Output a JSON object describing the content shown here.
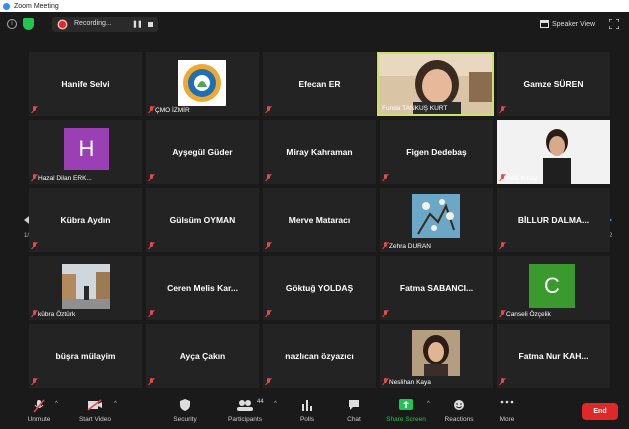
{
  "window": {
    "title": "Zoom Meeting"
  },
  "topbar": {
    "info_icon": "info-icon",
    "security_icon": "shield-icon",
    "recording_label": "Recording...",
    "pause_glyph": "❚❚",
    "speaker_view_label": "Speaker View",
    "colors": {
      "shield": "#23c552",
      "record": "#e02828"
    }
  },
  "pagination": {
    "prev_page": "1/2",
    "next_page": "1/2"
  },
  "participants": [
    {
      "name": "Hanife Selvi",
      "muted": true
    },
    {
      "name": "",
      "label": "ÇMO İZMİR",
      "muted": true,
      "logo_text": "ÇEVRE MÜHENDİSLERİ ODASI"
    },
    {
      "name": "Efecan ER",
      "muted": true
    },
    {
      "name": "",
      "label": "Funda TANKUŞ KURT",
      "muted": false,
      "active_speaker": true
    },
    {
      "name": "Gamze SÜREN",
      "muted": true
    },
    {
      "name": "",
      "label": "Hazal Dilan ERK...",
      "avatar_letter": "H",
      "avatar_color": "#9b3fb5",
      "muted": true
    },
    {
      "name": "Ayşegül Güder",
      "muted": true
    },
    {
      "name": "Miray Kahraman",
      "muted": true
    },
    {
      "name": "Figen Dedebaş",
      "muted": true
    },
    {
      "name": "",
      "label": "Helil Kınay",
      "muted": true
    },
    {
      "name": "Kübra Aydın",
      "muted": true
    },
    {
      "name": "Gülsüm OYMAN",
      "muted": true
    },
    {
      "name": "Merve Mataracı",
      "muted": true
    },
    {
      "name": "",
      "label": "Zehra DURAN",
      "muted": true
    },
    {
      "name": "BİLLUR DALMA...",
      "muted": true
    },
    {
      "name": "",
      "label": "kübra Öztürk",
      "muted": true
    },
    {
      "name": "Ceren Melis Kar...",
      "muted": true
    },
    {
      "name": "Göktuğ YOLDAŞ",
      "muted": true
    },
    {
      "name": "Fatma SABANCI...",
      "muted": true
    },
    {
      "name": "",
      "label": "Canseli Özçelik",
      "avatar_letter": "C",
      "avatar_color": "#3a9a2e",
      "muted": true
    },
    {
      "name": "büşra mülayim",
      "muted": true
    },
    {
      "name": "Ayça Çakın",
      "muted": true
    },
    {
      "name": "nazlıcan özyazıcı",
      "muted": true
    },
    {
      "name": "",
      "label": "Neslihan Kaya",
      "muted": true
    },
    {
      "name": "Fatma Nur KAH...",
      "muted": true
    }
  ],
  "toolbar": {
    "unmute": "Unmute",
    "start_video": "Start Video",
    "security": "Security",
    "participants": "Participants",
    "participants_count": "44",
    "polls": "Polls",
    "chat": "Chat",
    "share_screen": "Share Screen",
    "reactions": "Reactions",
    "more": "More",
    "end": "End",
    "colors": {
      "share": "#23c552",
      "end": "#e02828"
    }
  }
}
